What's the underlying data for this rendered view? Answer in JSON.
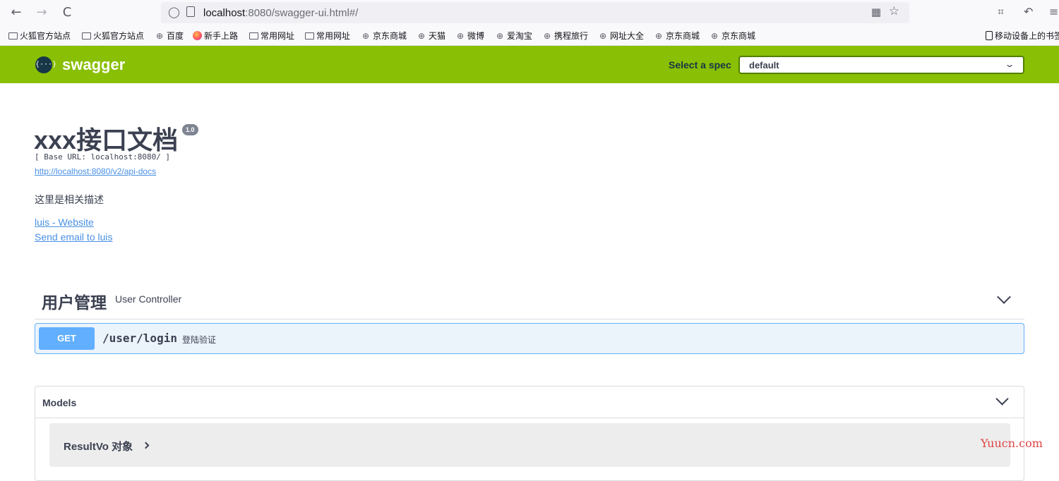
{
  "browser": {
    "url_host": "localhost",
    "url_rest": ":8080/swagger-ui.html#/",
    "back_glyph": "←",
    "forward_glyph": "→",
    "reload_glyph": "C",
    "qr_glyph": "▦",
    "star_glyph": "☆",
    "crop_glyph": "⌗",
    "undo_glyph": "↶",
    "menu_glyph": "≡"
  },
  "bookmarks": [
    {
      "label": "火狐官方站点",
      "icon": "folder-icon"
    },
    {
      "label": "火狐官方站点",
      "icon": "folder-icon"
    },
    {
      "label": "百度",
      "icon": "globe-icon"
    },
    {
      "label": "新手上路",
      "icon": "firefox-icon"
    },
    {
      "label": "常用网址",
      "icon": "folder-icon"
    },
    {
      "label": "常用网址",
      "icon": "folder-icon"
    },
    {
      "label": "京东商城",
      "icon": "globe-icon"
    },
    {
      "label": "天猫",
      "icon": "globe-icon"
    },
    {
      "label": "微博",
      "icon": "globe-icon"
    },
    {
      "label": "爱淘宝",
      "icon": "globe-icon"
    },
    {
      "label": "携程旅行",
      "icon": "globe-icon"
    },
    {
      "label": "网址大全",
      "icon": "globe-icon"
    },
    {
      "label": "京东商城",
      "icon": "globe-icon"
    },
    {
      "label": "京东商城",
      "icon": "globe-icon"
    }
  ],
  "mobile_bookmarks": "移动设备上的书签",
  "topbar": {
    "logo_glyph": "{···}",
    "logo_text": "swagger",
    "spec_label": "Select a spec",
    "spec_value": "default",
    "colors": {
      "bar": "#89bf04",
      "logo": "#173647"
    }
  },
  "info": {
    "title": "xxx接口文档",
    "version": "1.0",
    "base_url": "[ Base URL: localhost:8080/ ]",
    "api_docs_link": "http://localhost:8080/v2/api-docs",
    "description": "这里是相关描述",
    "contact_website": "luis - Website",
    "contact_email": "Send email to luis"
  },
  "tag": {
    "name": "用户管理",
    "description": "User Controller"
  },
  "operation": {
    "method": "GET",
    "path": "/user/login",
    "summary": "登陆验证",
    "color": "#61affe"
  },
  "models": {
    "title": "Models",
    "items": [
      {
        "name": "ResultVo 对象"
      }
    ]
  },
  "watermark": "Yuucn.com"
}
